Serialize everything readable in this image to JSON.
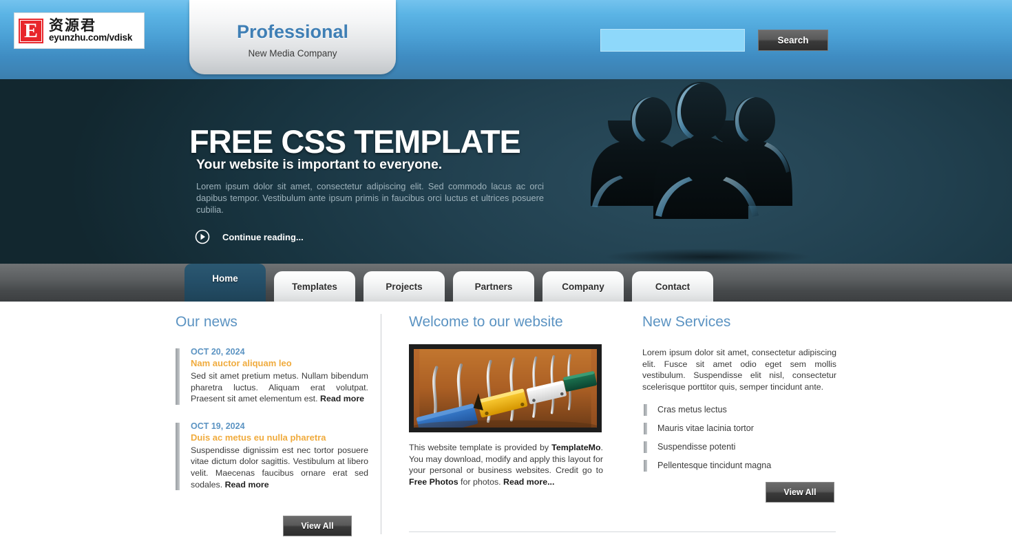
{
  "header": {
    "logo": {
      "mark_letter": "E",
      "cn_text": "资源君",
      "url_text": "eyunzhu.com/vdisk"
    },
    "brand": {
      "title": "Professional",
      "subtitle": "New Media Company"
    },
    "search": {
      "value": "",
      "placeholder": "",
      "button_label": "Search"
    }
  },
  "banner": {
    "heading": "FREE CSS TEMPLATE",
    "subheading": "Your website is important to everyone.",
    "paragraph": "Lorem ipsum dolor sit amet, consectetur adipiscing elit. Sed commodo lacus ac orci dapibus tempor. Vestibulum ante ipsum primis in faucibus orci luctus et ultrices posuere cubilia.",
    "cta_label": "Continue reading...",
    "cta_icon": "circle-play-icon",
    "image_alt": "three-people-silhouette-graphic"
  },
  "nav": {
    "items": [
      {
        "label": "Home",
        "active": true
      },
      {
        "label": "Templates",
        "active": false
      },
      {
        "label": "Projects",
        "active": false
      },
      {
        "label": "Partners",
        "active": false
      },
      {
        "label": "Company",
        "active": false
      },
      {
        "label": "Contact",
        "active": false
      }
    ]
  },
  "news": {
    "title": "Our news",
    "items": [
      {
        "date": "OCT 20, 2024",
        "headline": "Nam auctor aliquam leo",
        "body": "Sed sit amet pretium metus. Nullam bibendum pharetra luctus. Aliquam erat volutpat. Praesent sit amet elementum est. ",
        "read_more": "Read more"
      },
      {
        "date": "OCT 19, 2024",
        "headline": "Duis ac metus eu nulla pharetra",
        "body": "Suspendisse dignissim est nec tortor posuere vitae dictum dolor sagittis. Vestibulum at libero velit. Maecenas faucibus ornare erat sed sodales. ",
        "read_more": "Read more"
      }
    ],
    "view_all_label": "View All"
  },
  "welcome": {
    "title": "Welcome to our website",
    "photo_alt": "colored-binder-clips-photo",
    "body_part1": "This website template is provided by ",
    "link1": "TemplateMo",
    "body_part2": ". You may download, modify and apply this layout for your personal or business websites. Credit go to ",
    "link2": "Free Photos",
    "body_part3": " for photos. ",
    "read_more": "Read more..."
  },
  "services": {
    "title": "New Services",
    "body": "Lorem ipsum dolor sit amet, consectetur adipiscing elit. Fusce sit amet odio eget sem mollis vestibulum. Suspendisse elit nisl, consectetur scelerisque porttitor quis, semper tincidunt ante.",
    "items": [
      "Cras metus lectus",
      "Mauris vitae lacinia tortor",
      "Suspendisse potenti",
      "Pellentesque tincidunt magna"
    ],
    "view_all_label": "View All"
  },
  "colors": {
    "header_blue": "#4a9fd4",
    "banner_dark": "#21404f",
    "accent_blue": "#5b93c2",
    "news_headline_orange": "#f0ab3d",
    "nav_active": "#25506a",
    "button_dark": "#3a3a3a",
    "logo_red": "#e8262b",
    "search_field": "#8ed8fa"
  }
}
